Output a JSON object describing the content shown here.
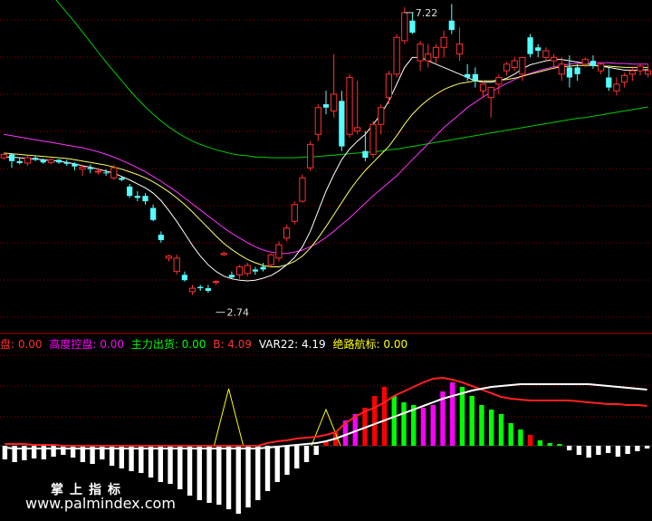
{
  "main_panel": {
    "high_label": "7.22",
    "low_label": "2.74"
  },
  "indicator_legend": [
    {
      "label": "盘: 0.00",
      "color": "#ff3030"
    },
    {
      "label": "高度控盘: 0.00",
      "color": "#ff00ff"
    },
    {
      "label": "主力出货: 0.00",
      "color": "#00ff00"
    },
    {
      "label": "B: 4.09",
      "color": "#ff3030"
    },
    {
      "label": "VAR22: 4.19",
      "color": "#ffffff"
    },
    {
      "label": "绝路航标: 0.00",
      "color": "#ffff00"
    }
  ],
  "watermark": {
    "line1": "掌上指标",
    "line2": "www.palmindex.com"
  },
  "colors": {
    "up": "#ff3030",
    "down": "#54ffff",
    "ma_white": "#ffffff",
    "ma_yellow": "#ffff66",
    "ma_magenta": "#ff33ff",
    "ma_green": "#00cc00",
    "grid": "#990000",
    "bar_red": "#ff0000",
    "bar_magenta": "#ff00ff",
    "bar_green": "#00ff00",
    "bar_white": "#ffffff"
  },
  "chart_data": {
    "type": "candlestick",
    "candles": [
      [
        5.05,
        5.12,
        5.02,
        5.1
      ],
      [
        5.1,
        5.12,
        4.9,
        5.0
      ],
      [
        5.0,
        5.05,
        4.95,
        4.97
      ],
      [
        4.97,
        5.08,
        4.93,
        5.05
      ],
      [
        5.05,
        5.08,
        5.0,
        5.02
      ],
      [
        5.02,
        5.04,
        4.96,
        4.98
      ],
      [
        4.98,
        5.04,
        4.95,
        5.02
      ],
      [
        5.02,
        5.03,
        4.96,
        4.98
      ],
      [
        4.98,
        5.02,
        4.93,
        4.96
      ],
      [
        4.96,
        4.98,
        4.86,
        4.92
      ],
      [
        4.88,
        4.95,
        4.78,
        4.91
      ],
      [
        4.9,
        4.95,
        4.82,
        4.88
      ],
      [
        4.85,
        4.9,
        4.8,
        4.85
      ],
      [
        4.83,
        4.88,
        4.78,
        4.82
      ],
      [
        4.75,
        4.95,
        4.72,
        4.9
      ],
      [
        4.75,
        4.78,
        4.7,
        4.72
      ],
      [
        4.62,
        4.66,
        4.45,
        4.48
      ],
      [
        4.48,
        4.55,
        4.4,
        4.45
      ],
      [
        4.48,
        4.52,
        4.35,
        4.4
      ],
      [
        4.3,
        4.35,
        4.1,
        4.12
      ],
      [
        3.9,
        3.95,
        3.78,
        3.82
      ],
      [
        3.55,
        3.6,
        3.5,
        3.58
      ],
      [
        3.35,
        3.6,
        3.3,
        3.55
      ],
      [
        3.3,
        3.35,
        3.2,
        3.22
      ],
      [
        3.05,
        3.15,
        3.0,
        3.1
      ],
      [
        3.12,
        3.15,
        3.06,
        3.1
      ],
      [
        3.1,
        3.15,
        3.03,
        3.06
      ],
      [
        3.2,
        3.22,
        3.15,
        3.2
      ],
      [
        3.6,
        3.65,
        3.58,
        3.62
      ],
      [
        3.3,
        3.35,
        3.24,
        3.26
      ],
      [
        3.3,
        3.45,
        3.24,
        3.42
      ],
      [
        3.32,
        3.48,
        3.28,
        3.44
      ],
      [
        3.38,
        3.42,
        3.3,
        3.35
      ],
      [
        3.42,
        3.48,
        3.35,
        3.38
      ],
      [
        3.45,
        3.62,
        3.42,
        3.6
      ],
      [
        3.55,
        3.8,
        3.5,
        3.75
      ],
      [
        3.85,
        4.05,
        3.8,
        4.0
      ],
      [
        4.1,
        4.4,
        4.05,
        4.35
      ],
      [
        4.4,
        4.8,
        4.38,
        4.75
      ],
      [
        4.9,
        5.3,
        4.85,
        5.25
      ],
      [
        5.4,
        5.85,
        5.3,
        5.8
      ],
      [
        5.85,
        6.05,
        5.7,
        5.8
      ],
      [
        5.75,
        6.6,
        5.65,
        6.0
      ],
      [
        5.9,
        6.05,
        5.15,
        5.22
      ],
      [
        5.4,
        6.3,
        5.35,
        6.25
      ],
      [
        5.45,
        6.2,
        5.4,
        5.5
      ],
      [
        5.15,
        5.45,
        5.0,
        5.05
      ],
      [
        5.1,
        5.6,
        5.05,
        5.55
      ],
      [
        5.55,
        5.85,
        5.4,
        5.8
      ],
      [
        5.95,
        6.35,
        5.85,
        6.3
      ],
      [
        6.3,
        6.9,
        6.25,
        6.85
      ],
      [
        6.8,
        7.3,
        6.75,
        7.22
      ],
      [
        7.1,
        7.22,
        6.9,
        6.92
      ],
      [
        6.5,
        6.8,
        6.35,
        6.75
      ],
      [
        6.5,
        6.75,
        6.4,
        6.6
      ],
      [
        6.55,
        6.75,
        6.45,
        6.7
      ],
      [
        6.7,
        6.95,
        6.55,
        6.85
      ],
      [
        7.1,
        7.35,
        6.9,
        6.96
      ],
      [
        6.6,
        7.0,
        6.5,
        6.75
      ],
      [
        6.3,
        6.45,
        6.2,
        6.25
      ],
      [
        6.3,
        6.4,
        6.1,
        6.2
      ],
      [
        6.05,
        6.2,
        5.95,
        6.15
      ],
      [
        5.95,
        6.1,
        5.65,
        6.1
      ],
      [
        6.15,
        6.3,
        6.0,
        6.25
      ],
      [
        6.35,
        6.48,
        6.28,
        6.45
      ],
      [
        6.4,
        6.55,
        6.35,
        6.5
      ],
      [
        6.3,
        6.55,
        6.2,
        6.55
      ],
      [
        6.85,
        6.9,
        6.55,
        6.6
      ],
      [
        6.7,
        6.75,
        6.55,
        6.65
      ],
      [
        6.55,
        6.7,
        6.5,
        6.65
      ],
      [
        6.5,
        6.6,
        6.4,
        6.55
      ],
      [
        6.3,
        6.55,
        6.2,
        6.45
      ],
      [
        6.4,
        6.58,
        6.1,
        6.25
      ],
      [
        6.4,
        6.45,
        6.2,
        6.3
      ],
      [
        6.45,
        6.55,
        6.4,
        6.52
      ],
      [
        6.5,
        6.58,
        6.38,
        6.42
      ],
      [
        6.35,
        6.48,
        6.3,
        6.45
      ],
      [
        6.25,
        6.4,
        6.05,
        6.1
      ],
      [
        6.05,
        6.25,
        5.98,
        6.15
      ],
      [
        6.18,
        6.32,
        6.1,
        6.28
      ],
      [
        6.3,
        6.4,
        6.2,
        6.35
      ],
      [
        6.35,
        6.45,
        6.28,
        6.42
      ],
      [
        6.3,
        6.45,
        6.25,
        6.35
      ]
    ],
    "y_range": [
      2.6,
      7.3
    ],
    "high_marker": {
      "value": 7.22,
      "index": 51
    },
    "low_marker": {
      "value": 2.74,
      "index": 27
    },
    "ma_lines": {
      "white": [
        5.06,
        5.06,
        5.05,
        5.04,
        5.03,
        5.02,
        5.01,
        5.0,
        4.98,
        4.96,
        4.93,
        4.91,
        4.88,
        4.85,
        4.82,
        4.77,
        4.72,
        4.66,
        4.6,
        4.52,
        4.41,
        4.26,
        4.1,
        3.92,
        3.74,
        3.58,
        3.45,
        3.35,
        3.28,
        3.24,
        3.22,
        3.21,
        3.22,
        3.25,
        3.29,
        3.36,
        3.45,
        3.56,
        3.72,
        3.95,
        4.25,
        4.55,
        4.8,
        5.02,
        5.18,
        5.3,
        5.4,
        5.55,
        5.7,
        5.9,
        6.15,
        6.4,
        6.55,
        6.55,
        6.5,
        6.45,
        6.4,
        6.35,
        6.3,
        6.25,
        6.2,
        6.18,
        6.18,
        6.2,
        6.24,
        6.3,
        6.38,
        6.44,
        6.47,
        6.5,
        6.52,
        6.52,
        6.5,
        6.48,
        6.46,
        6.44,
        6.42,
        6.4,
        6.38,
        6.36,
        6.36,
        6.36,
        6.37
      ],
      "yellow": [
        5.12,
        5.11,
        5.1,
        5.09,
        5.08,
        5.07,
        5.06,
        5.05,
        5.04,
        5.02,
        5.0,
        4.98,
        4.96,
        4.94,
        4.91,
        4.88,
        4.84,
        4.8,
        4.75,
        4.69,
        4.62,
        4.54,
        4.45,
        4.35,
        4.24,
        4.12,
        4.0,
        3.88,
        3.77,
        3.68,
        3.6,
        3.53,
        3.48,
        3.44,
        3.42,
        3.42,
        3.45,
        3.5,
        3.58,
        3.7,
        3.85,
        4.02,
        4.2,
        4.38,
        4.56,
        4.72,
        4.86,
        4.98,
        5.1,
        5.22,
        5.38,
        5.55,
        5.7,
        5.82,
        5.92,
        6.0,
        6.07,
        6.12,
        6.16,
        6.18,
        6.2,
        6.2,
        6.2,
        6.21,
        6.22,
        6.24,
        6.27,
        6.3,
        6.33,
        6.36,
        6.39,
        6.41,
        6.42,
        6.43,
        6.43,
        6.43,
        6.42,
        6.42,
        6.41,
        6.4,
        6.4,
        6.4,
        6.4
      ],
      "magenta": [
        5.4,
        5.38,
        5.36,
        5.34,
        5.32,
        5.3,
        5.28,
        5.26,
        5.24,
        5.22,
        5.2,
        5.17,
        5.14,
        5.1,
        5.06,
        5.01,
        4.96,
        4.9,
        4.84,
        4.77,
        4.7,
        4.62,
        4.54,
        4.45,
        4.36,
        4.27,
        4.18,
        4.09,
        4.0,
        3.92,
        3.85,
        3.78,
        3.72,
        3.67,
        3.64,
        3.62,
        3.62,
        3.64,
        3.67,
        3.72,
        3.78,
        3.86,
        3.95,
        4.05,
        4.15,
        4.26,
        4.37,
        4.48,
        4.58,
        4.68,
        4.78,
        4.9,
        5.02,
        5.14,
        5.26,
        5.38,
        5.5,
        5.6,
        5.7,
        5.8,
        5.88,
        5.96,
        6.03,
        6.1,
        6.16,
        6.22,
        6.27,
        6.31,
        6.35,
        6.38,
        6.41,
        6.43,
        6.45,
        6.46,
        6.47,
        6.47,
        6.47,
        6.47,
        6.46,
        6.46,
        6.45,
        6.45,
        6.45
      ],
      "green": [
        8.2,
        8.1,
        8.0,
        7.88,
        7.76,
        7.63,
        7.5,
        7.36,
        7.22,
        7.08,
        6.93,
        6.78,
        6.63,
        6.48,
        6.34,
        6.2,
        6.06,
        5.93,
        5.81,
        5.7,
        5.6,
        5.51,
        5.43,
        5.36,
        5.3,
        5.25,
        5.21,
        5.17,
        5.14,
        5.11,
        5.09,
        5.08,
        5.06,
        5.06,
        5.05,
        5.05,
        5.05,
        5.05,
        5.06,
        5.06,
        5.07,
        5.08,
        5.09,
        5.1,
        5.11,
        5.12,
        5.13,
        5.14,
        5.15,
        5.17,
        5.18,
        5.2,
        5.22,
        5.24,
        5.26,
        5.28,
        5.3,
        5.32,
        5.34,
        5.36,
        5.38,
        5.4,
        5.42,
        5.44,
        5.46,
        5.48,
        5.5,
        5.52,
        5.54,
        5.56,
        5.58,
        5.6,
        5.62,
        5.64,
        5.65,
        5.67,
        5.69,
        5.71,
        5.73,
        5.75,
        5.77,
        5.79,
        5.81
      ]
    },
    "indicator": {
      "y_range": [
        -8,
        10
      ],
      "bars": [
        -1.5,
        -1.8,
        -1.6,
        -1.4,
        -1.5,
        -1.2,
        -1.0,
        -1.3,
        -1.8,
        -2.0,
        -1.5,
        -2.2,
        -2.5,
        -2.8,
        -3.0,
        -3.5,
        -4.0,
        -4.2,
        -4.8,
        -5.5,
        -6.0,
        -6.3,
        -6.5,
        -7.0,
        -7.5,
        -6.8,
        -6.0,
        -5.0,
        -4.0,
        -3.2,
        -2.5,
        -1.8,
        -1.0,
        0.5,
        1.5,
        2.8,
        3.5,
        4.2,
        5.5,
        6.5,
        5.5,
        4.8,
        4.5,
        4.2,
        4.5,
        6.0,
        7.0,
        6.5,
        5.5,
        4.5,
        4.0,
        3.5,
        2.5,
        1.8,
        1.2,
        0.6,
        0.3,
        0.2,
        -0.5,
        -1.0,
        -1.3,
        -1.0,
        -0.8,
        -1.2,
        -0.9,
        -0.6,
        -0.3
      ],
      "bar_colors": [
        "white",
        "white",
        "white",
        "white",
        "white",
        "white",
        "white",
        "white",
        "white",
        "white",
        "white",
        "white",
        "white",
        "white",
        "white",
        "white",
        "white",
        "white",
        "white",
        "white",
        "white",
        "white",
        "white",
        "white",
        "white",
        "white",
        "white",
        "white",
        "white",
        "white",
        "white",
        "white",
        "white",
        "red",
        "red",
        "magenta",
        "magenta",
        "red",
        "red",
        "red",
        "green",
        "green",
        "green",
        "magenta",
        "magenta",
        "magenta",
        "magenta",
        "green",
        "green",
        "green",
        "green",
        "green",
        "green",
        "green",
        "red",
        "green",
        "green",
        "green",
        "white",
        "white",
        "white",
        "white",
        "white",
        "white",
        "white",
        "white",
        "white"
      ],
      "red_line": [
        0.2,
        0.2,
        0.2,
        0.1,
        0.1,
        0.1,
        0.0,
        0.0,
        0.0,
        0.0,
        0.0,
        0.0,
        0.0,
        0.0,
        0.0,
        0.0,
        0.0,
        0.0,
        0.0,
        0.0,
        0.0,
        0.0,
        0.0,
        0.0,
        0.0,
        0.0,
        0.0,
        0.3,
        0.5,
        0.6,
        0.8,
        0.9,
        1.0,
        1.2,
        1.5,
        2.5,
        3.2,
        3.8,
        4.2,
        4.8,
        5.5,
        6.0,
        6.5,
        7.0,
        7.4,
        7.5,
        7.3,
        7.0,
        6.6,
        6.2,
        5.8,
        5.4,
        5.2,
        5.1,
        5.0,
        5.0,
        5.0,
        5.0,
        5.0,
        4.9,
        4.8,
        4.7,
        4.6,
        4.6,
        4.5,
        4.5,
        4.4
      ],
      "white_line": [
        -0.2,
        -0.3,
        -0.3,
        -0.3,
        -0.3,
        -0.3,
        -0.3,
        -0.3,
        -0.3,
        -0.3,
        -0.3,
        -0.3,
        -0.3,
        -0.3,
        -0.3,
        -0.3,
        -0.3,
        -0.3,
        -0.3,
        -0.3,
        -0.3,
        -0.3,
        -0.3,
        -0.3,
        -0.3,
        -0.3,
        -0.3,
        -0.2,
        -0.1,
        0.0,
        0.1,
        0.2,
        0.3,
        0.5,
        0.8,
        1.2,
        1.6,
        2.0,
        2.4,
        2.8,
        3.2,
        3.6,
        4.0,
        4.4,
        4.8,
        5.2,
        5.5,
        5.8,
        6.1,
        6.3,
        6.5,
        6.6,
        6.7,
        6.8,
        6.8,
        6.8,
        6.8,
        6.8,
        6.8,
        6.8,
        6.8,
        6.7,
        6.6,
        6.5,
        6.4,
        6.3,
        6.2
      ],
      "yellow_spikes": [
        {
          "index": 23,
          "value": 6.3
        },
        {
          "index": 33,
          "value": 4.0
        }
      ]
    }
  }
}
